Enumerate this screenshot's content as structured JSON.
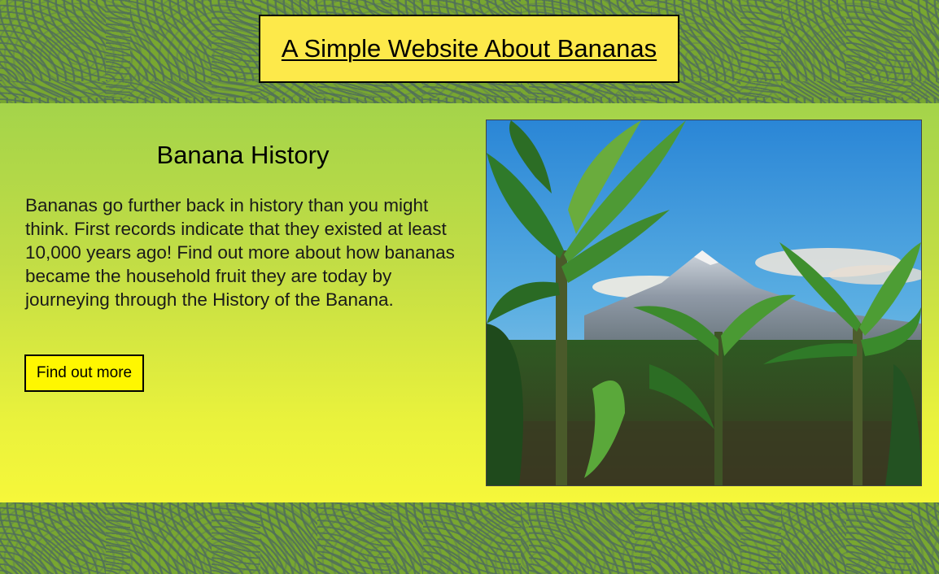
{
  "header": {
    "title": "A Simple Website About Bananas"
  },
  "section": {
    "heading": "Banana History",
    "body": "Bananas go further back in history than you might think. First records indicate that they existed at least 10,000 years ago! Find out more about how bananas became the household fruit they are today by journeying through the History of the Banana.",
    "button_label": "Find out more"
  },
  "image": {
    "subject": "banana plantation with mountain and blue sky"
  },
  "colors": {
    "title_box_bg": "#fde94a",
    "button_bg": "#fff700",
    "panel_top": "#a4d44a",
    "panel_bottom": "#f6f73a",
    "pattern_green": "#78a730"
  }
}
